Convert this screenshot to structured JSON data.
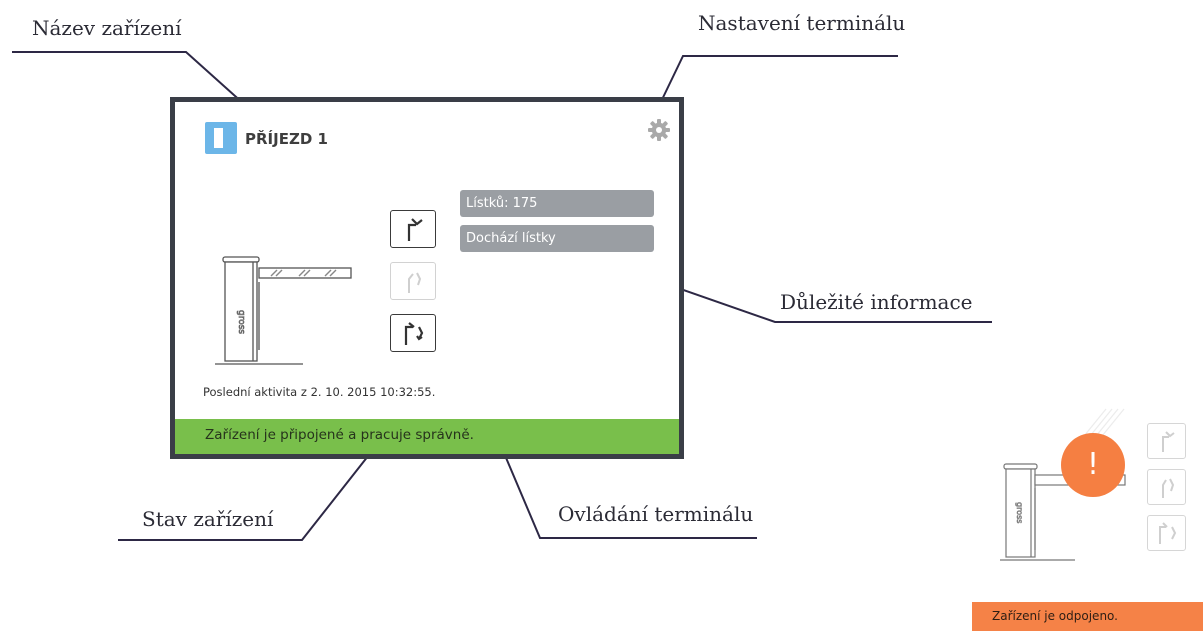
{
  "callouts": {
    "device_name": "Název zařízení",
    "terminal_settings": "Nastavení terminálu",
    "important_info": "Důležité informace",
    "device_status": "Stav zařízení",
    "terminal_control": "Ovládání terminálu"
  },
  "card": {
    "title": "PŘÍJEZD 1",
    "barrier_brand": "gross",
    "info": [
      "Lístků: 175",
      "Dochází lístky"
    ],
    "last_activity": "Poslední aktivita z 2. 10. 2015 10:32:55.",
    "status": "Zařízení je připojené a pracuje správně.",
    "status_color": "#79bf4b",
    "controls": [
      "open-barrier-icon",
      "close-barrier-icon",
      "open-close-barrier-icon"
    ]
  },
  "disconnected": {
    "alert_symbol": "!",
    "barrier_brand": "gross",
    "status": "Zařízení je odpojeno.",
    "status_color": "#f58247"
  }
}
